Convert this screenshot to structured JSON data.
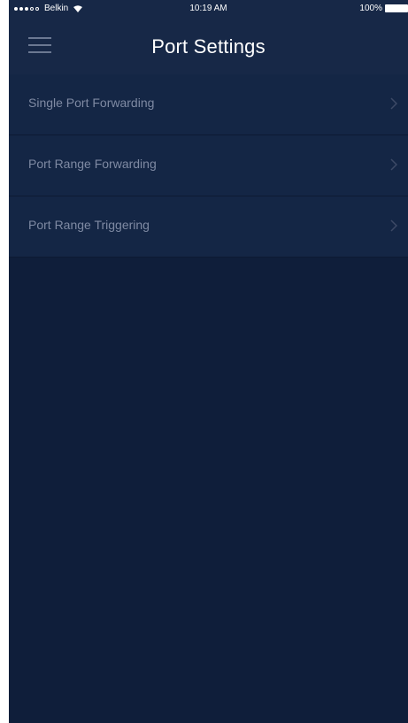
{
  "status_bar": {
    "carrier": "Belkin",
    "time": "10:19 AM",
    "battery": "100%",
    "icons": [
      "signal-icon",
      "wifi-icon",
      "battery-icon"
    ]
  },
  "header": {
    "title": "Port Settings",
    "menu_icon": "hamburger-menu-icon"
  },
  "settings": {
    "items": [
      {
        "label": "Single Port Forwarding",
        "icon": "chevron-right-icon"
      },
      {
        "label": "Port Range Forwarding",
        "icon": "chevron-right-icon"
      },
      {
        "label": "Port Range Triggering",
        "icon": "chevron-right-icon"
      }
    ]
  },
  "colors": {
    "background": "#0f1e3a",
    "header": "#172847",
    "list_item": "#142645",
    "label_text": "#7f8aa3",
    "title_text": "#ffffff"
  }
}
